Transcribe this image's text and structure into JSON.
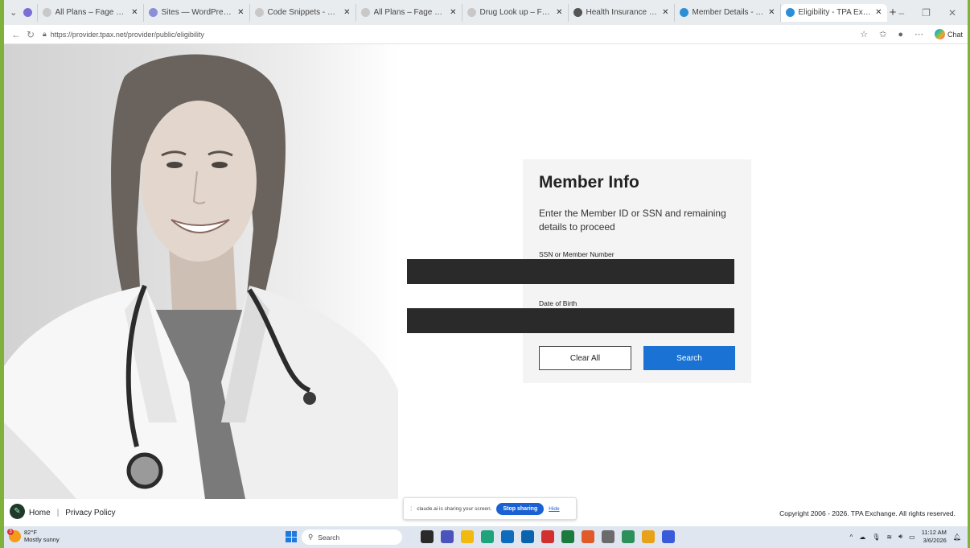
{
  "browser": {
    "tabs": [
      {
        "title": "",
        "icon": "edge-favicon",
        "pinned": true
      },
      {
        "title": "All Plans – Fage Financial",
        "icon": "document-icon"
      },
      {
        "title": "Sites — WordPress.com",
        "icon": "wordpress-icon"
      },
      {
        "title": "Code Snippets - Fage Finan",
        "icon": "document-icon"
      },
      {
        "title": "All Plans – Fage Financial",
        "icon": "document-icon"
      },
      {
        "title": "Drug Look up – Fage Finan",
        "icon": "document-icon"
      },
      {
        "title": "Health Insurance | Benefit",
        "icon": "globe-icon"
      },
      {
        "title": "Member Details - TPA Exch",
        "icon": "tpa-icon"
      },
      {
        "title": "Eligibility - TPA Exchange",
        "icon": "tpa-icon",
        "active": true
      }
    ],
    "url": "https://provider.tpax.net/provider/public/eligibility",
    "chat_label": "Chat"
  },
  "form": {
    "title": "Member Info",
    "description": "Enter the Member ID or SSN and remaining details to proceed",
    "ssn_label": "SSN or Member Number",
    "dob_label": "Date of Birth",
    "clear_label": "Clear All",
    "search_label": "Search",
    "accent": "#1a73d4"
  },
  "footer": {
    "home": "Home",
    "separator": "|",
    "privacy": "Privacy Policy",
    "copyright": "Copyright 2006 - 2026. TPA Exchange. All rights reserved."
  },
  "share_bar": {
    "message": "claude.ai is sharing your screen.",
    "stop": "Stop sharing",
    "hide": "Hide"
  },
  "taskbar": {
    "temperature": "82°F",
    "weather": "Mostly sunny",
    "weather_badge": "3",
    "search_placeholder": "Search",
    "time": "11:12 AM",
    "date": "3/6/2026"
  }
}
